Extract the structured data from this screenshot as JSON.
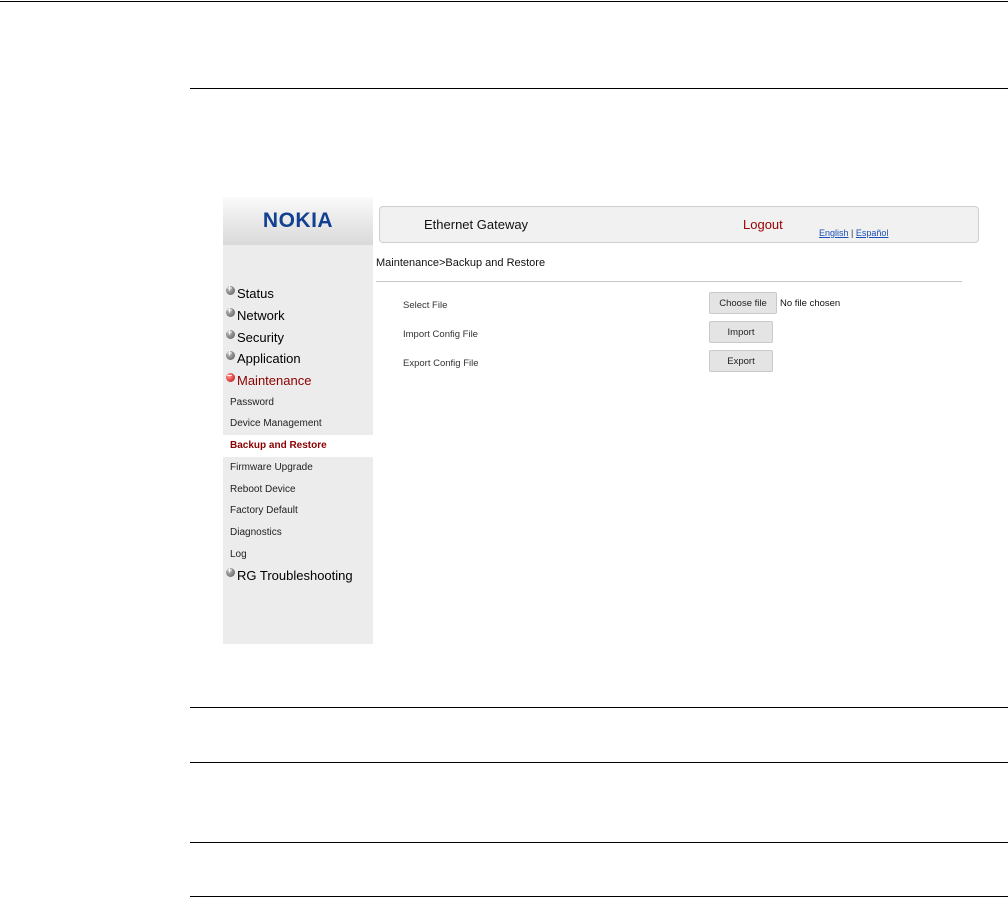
{
  "header": {
    "brand": "NOKIA",
    "title": "Ethernet Gateway",
    "logout": "Logout",
    "lang_english": "English",
    "lang_separator": "|",
    "lang_espanol": "Español"
  },
  "breadcrumb": "Maintenance>Backup and Restore",
  "sidebar": {
    "sections": [
      "Status",
      "Network",
      "Security",
      "Application",
      "Maintenance"
    ],
    "maintenance_items": [
      "Password",
      "Device Management",
      "Backup and Restore",
      "Firmware Upgrade",
      "Reboot Device",
      "Factory Default",
      "Diagnostics",
      "Log"
    ],
    "last_section": "RG Troubleshooting"
  },
  "form": {
    "select_file_label": "Select File",
    "choose_file_button": "Choose file",
    "no_file_text": "No file chosen",
    "import_label": "Import Config File",
    "import_button": "Import",
    "export_label": "Export Config File",
    "export_button": "Export"
  },
  "colors": {
    "brand": "#124191",
    "accent": "#8b0000",
    "link": "#1a4fb5"
  }
}
